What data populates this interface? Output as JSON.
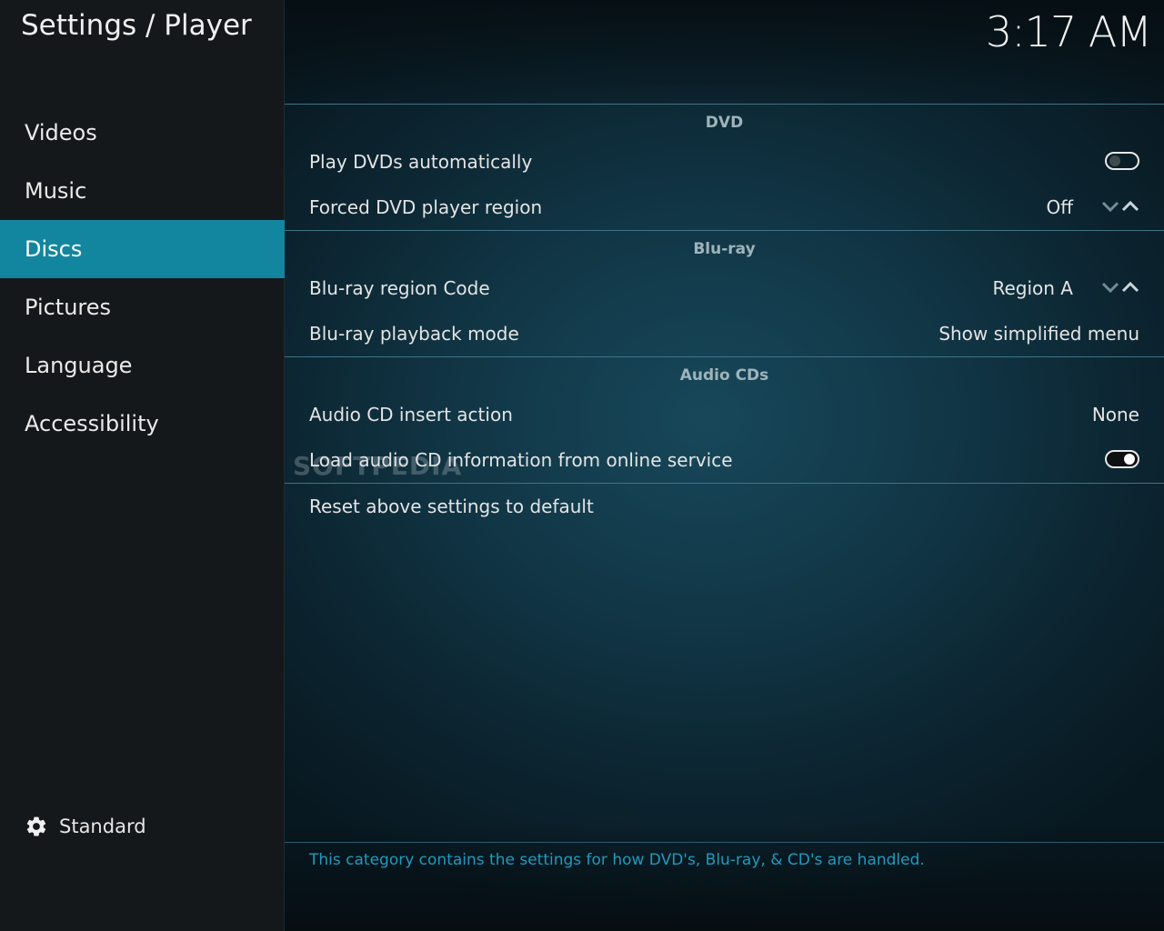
{
  "header": {
    "title": "Settings / Player",
    "clock": "3:17 AM"
  },
  "sidebar": {
    "items": [
      {
        "label": "Videos"
      },
      {
        "label": "Music"
      },
      {
        "label": "Discs",
        "active": true
      },
      {
        "label": "Pictures"
      },
      {
        "label": "Language"
      },
      {
        "label": "Accessibility"
      }
    ],
    "settings_level": {
      "icon": "gear-icon",
      "label": "Standard"
    }
  },
  "groups": [
    {
      "header": "DVD",
      "rows": [
        {
          "label": "Play DVDs automatically",
          "type": "toggle",
          "state": "off"
        },
        {
          "label": "Forced DVD player region",
          "type": "spinner",
          "value": "Off"
        }
      ]
    },
    {
      "header": "Blu-ray",
      "rows": [
        {
          "label": "Blu-ray region Code",
          "type": "spinner",
          "value": "Region A"
        },
        {
          "label": "Blu-ray playback mode",
          "type": "list",
          "value": "Show simplified menu"
        }
      ]
    },
    {
      "header": "Audio CDs",
      "rows": [
        {
          "label": "Audio CD insert action",
          "type": "list",
          "value": "None"
        },
        {
          "label": "Load audio CD information from online service",
          "type": "toggle",
          "state": "on"
        }
      ]
    }
  ],
  "reset": {
    "label": "Reset above settings to default"
  },
  "description": "This category contains the settings for how DVD's, Blu-ray, & CD's are handled.",
  "watermark": "SOFTPEDIA",
  "colors": {
    "accent": "#12869f",
    "description_text": "#1e9bbf",
    "sidebar_bg": "#15181a"
  }
}
